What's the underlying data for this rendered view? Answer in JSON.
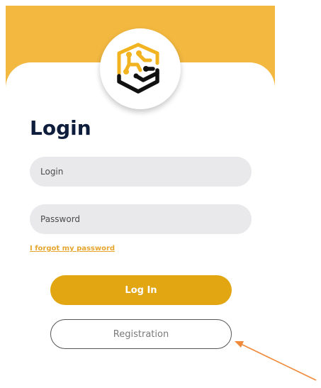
{
  "login_screen": {
    "title": "Login",
    "login_field": {
      "placeholder": "Login",
      "value": ""
    },
    "password_field": {
      "placeholder": "Password",
      "value": ""
    },
    "forgot_password_label": "I forgot my password",
    "login_button_label": "Log In",
    "registration_button_label": "Registration"
  },
  "logo": {
    "icon": "circuit-hexagon-logo-icon"
  },
  "annotation": {
    "icon": "arrow-icon",
    "color": "#f08a3a"
  },
  "colors": {
    "header_yellow": "#f2b840",
    "primary_button": "#e1a611",
    "link": "#e6a52f",
    "title": "#0f1d3d",
    "field_background": "#e9e9eb"
  }
}
